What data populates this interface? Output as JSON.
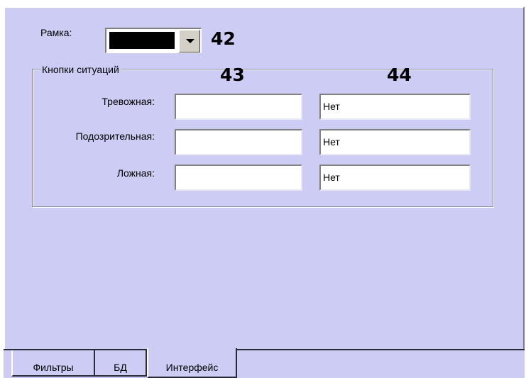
{
  "frame": {
    "label": "Рамка:",
    "selected_color": "#000000",
    "callout": "42"
  },
  "situation_buttons": {
    "legend": "Кнопки ситуаций",
    "callout_col1": "43",
    "callout_col2": "44",
    "rows": [
      {
        "label": "Тревожная:",
        "value_col1": "",
        "value_col2": "Нет"
      },
      {
        "label": "Подозрительная:",
        "value_col1": "",
        "value_col2": "Нет"
      },
      {
        "label": "Ложная:",
        "value_col1": "",
        "value_col2": "Нет"
      }
    ]
  },
  "tabs": [
    {
      "label": "Фильтры",
      "active": false
    },
    {
      "label": "БД",
      "active": false
    },
    {
      "label": "Интерфейс",
      "active": true
    }
  ],
  "colors": {
    "panel_background": "#ccccf4",
    "field_background": "#ffffff",
    "swatch": "#000000"
  },
  "icons": {
    "dropdown_arrow": "chevron-down-icon"
  }
}
